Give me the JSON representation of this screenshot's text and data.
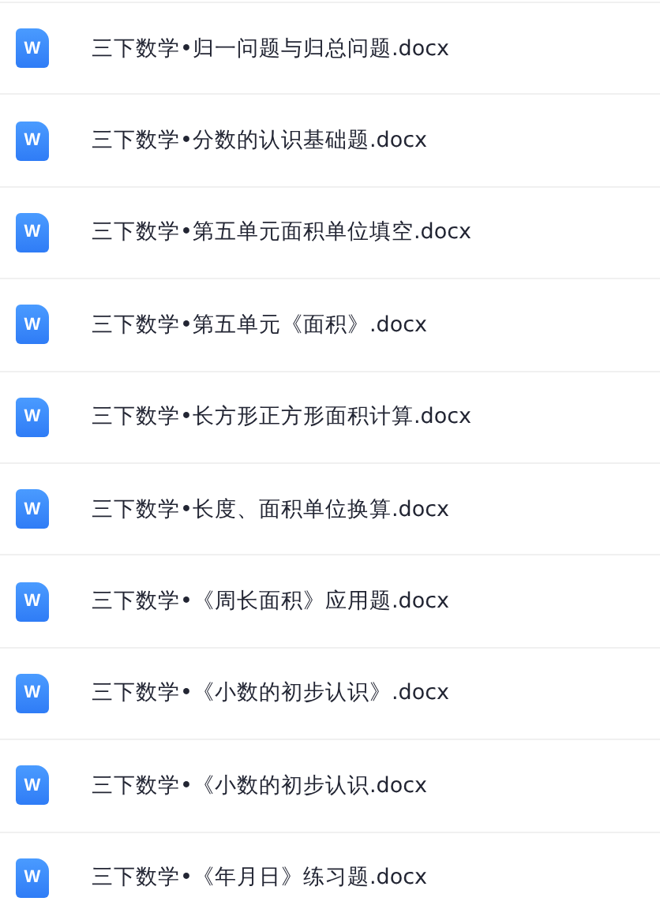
{
  "files": [
    {
      "icon_letter": "W",
      "name": "三下数学•归一问题与归总问题.docx"
    },
    {
      "icon_letter": "W",
      "name": "三下数学•分数的认识基础题.docx"
    },
    {
      "icon_letter": "W",
      "name": "三下数学•第五单元面积单位填空.docx"
    },
    {
      "icon_letter": "W",
      "name": "三下数学•第五单元《面积》.docx"
    },
    {
      "icon_letter": "W",
      "name": "三下数学•长方形正方形面积计算.docx"
    },
    {
      "icon_letter": "W",
      "name": "三下数学•长度、面积单位换算.docx"
    },
    {
      "icon_letter": "W",
      "name": "三下数学•《周长面积》应用题.docx"
    },
    {
      "icon_letter": "W",
      "name": "三下数学•《小数的初步认识》.docx"
    },
    {
      "icon_letter": "W",
      "name": "三下数学•《小数的初步认识.docx"
    },
    {
      "icon_letter": "W",
      "name": "三下数学•《年月日》练习题.docx"
    }
  ]
}
